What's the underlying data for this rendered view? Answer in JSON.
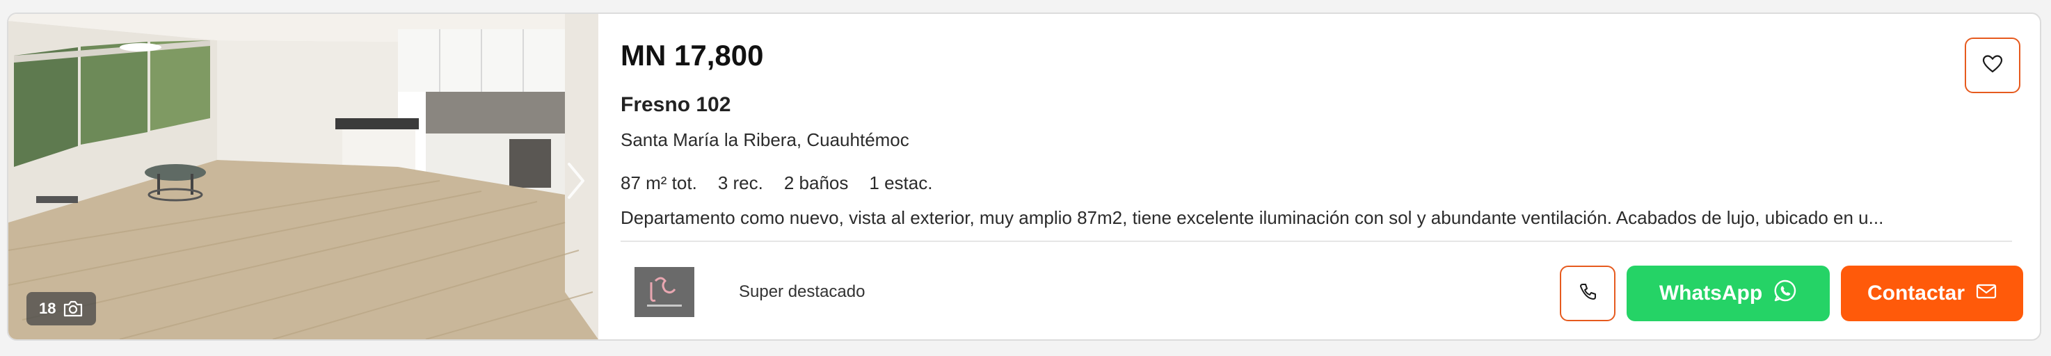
{
  "listing": {
    "price": "MN 17,800",
    "title": "Fresno 102",
    "location": "Santa María la Ribera, Cuauhtémoc",
    "features": {
      "area": "87 m² tot.",
      "rooms": "3 rec.",
      "baths": "2 baños",
      "parking": "1 estac."
    },
    "description": "Departamento como nuevo, vista al exterior, muy amplio 87m2, tiene excelente iluminación con sol y abundante ventilación. Acabados de lujo, ubicado en u..."
  },
  "photo": {
    "count": "18"
  },
  "publisher": {
    "badge": "Super destacado"
  },
  "actions": {
    "whatsapp_label": "WhatsApp",
    "contact_label": "Contactar"
  },
  "colors": {
    "accent": "#e65a1e",
    "contact": "#ff5a0a",
    "whatsapp": "#25d366"
  },
  "icons": {
    "favorite": "heart-icon",
    "photo_count": "camera-icon",
    "next_photo": "chevron-right-icon",
    "phone": "phone-icon",
    "whatsapp": "whatsapp-icon",
    "contact": "envelope-icon"
  }
}
